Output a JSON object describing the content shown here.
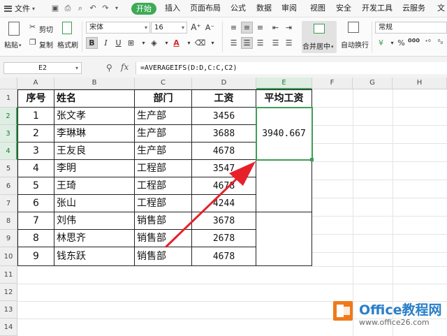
{
  "menu": {
    "file_label": "文件",
    "tabs": [
      {
        "label": "开始",
        "active": true
      },
      {
        "label": "插入"
      },
      {
        "label": "页面布局"
      },
      {
        "label": "公式"
      },
      {
        "label": "数据"
      },
      {
        "label": "审阅"
      },
      {
        "label": "视图"
      },
      {
        "label": "安全"
      },
      {
        "label": "开发工具"
      },
      {
        "label": "云服务"
      },
      {
        "label": "文"
      }
    ]
  },
  "ribbon": {
    "paste_label": "粘贴",
    "cut_label": "剪切",
    "copy_label": "复制",
    "format_painter_label": "格式刷",
    "font_name": "宋体",
    "font_size": "16",
    "merge_label": "合并居中",
    "wrap_label": "自动换行",
    "number_format": "常规"
  },
  "formula_bar": {
    "cell_ref": "E2",
    "fx": "fx",
    "formula": "=AVERAGEIFS(D:D,C:C,C2)"
  },
  "sheet": {
    "columns": [
      "A",
      "B",
      "C",
      "D",
      "E",
      "F",
      "G",
      "H"
    ],
    "rows": [
      "1",
      "2",
      "3",
      "4",
      "5",
      "6",
      "7",
      "8",
      "9",
      "10",
      "11",
      "12",
      "13",
      "14"
    ],
    "headers": [
      "序号",
      "姓名",
      "部门",
      "工资",
      "平均工资"
    ],
    "records": [
      {
        "no": "1",
        "name": "张文孝",
        "dept": "生产部",
        "salary": "3456"
      },
      {
        "no": "2",
        "name": "李琳琳",
        "dept": "生产部",
        "salary": "3688"
      },
      {
        "no": "3",
        "name": "王友良",
        "dept": "生产部",
        "salary": "4678"
      },
      {
        "no": "4",
        "name": "李明",
        "dept": "工程部",
        "salary": "3547"
      },
      {
        "no": "5",
        "name": "王琦",
        "dept": "工程部",
        "salary": "4678"
      },
      {
        "no": "6",
        "name": "张山",
        "dept": "工程部",
        "salary": "4244"
      },
      {
        "no": "7",
        "name": "刘伟",
        "dept": "销售部",
        "salary": "3678"
      },
      {
        "no": "8",
        "name": "林思齐",
        "dept": "销售部",
        "salary": "2678"
      },
      {
        "no": "9",
        "name": "钱东跃",
        "dept": "销售部",
        "salary": "4678"
      }
    ],
    "average_result": "3940.667"
  },
  "watermark": {
    "title": "Office教程网",
    "url": "www.office26.com"
  },
  "colors": {
    "accent": "#3daa56",
    "arrow": "#e8202a",
    "logo_blue": "#2a7fc8",
    "logo_orange": "#f07a1a"
  }
}
